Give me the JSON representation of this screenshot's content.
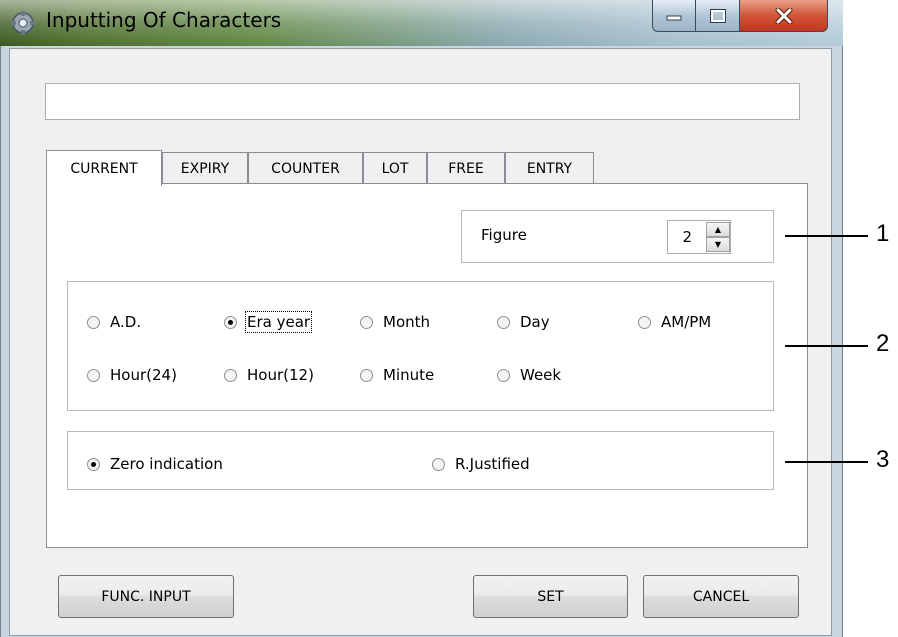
{
  "window": {
    "title": "Inputting Of Characters",
    "controls": {
      "minimize": "minimize",
      "maximize": "maximize",
      "close": "close"
    }
  },
  "text_input": {
    "value": "",
    "placeholder": ""
  },
  "tabs": [
    {
      "label": "CURRENT",
      "active": true
    },
    {
      "label": "EXPIRY",
      "active": false
    },
    {
      "label": "COUNTER",
      "active": false
    },
    {
      "label": "LOT",
      "active": false
    },
    {
      "label": "FREE",
      "active": false
    },
    {
      "label": "ENTRY",
      "active": false
    }
  ],
  "figure": {
    "label": "Figure",
    "value": "2",
    "up": "▲",
    "down": "▼"
  },
  "date_options": [
    {
      "label": "A.D.",
      "checked": false
    },
    {
      "label": "Era year",
      "checked": true
    },
    {
      "label": "Month",
      "checked": false
    },
    {
      "label": "Day",
      "checked": false
    },
    {
      "label": "AM/PM",
      "checked": false
    },
    {
      "label": "Hour(24)",
      "checked": false
    },
    {
      "label": "Hour(12)",
      "checked": false
    },
    {
      "label": "Minute",
      "checked": false
    },
    {
      "label": "Week",
      "checked": false
    }
  ],
  "justify_options": [
    {
      "label": "Zero indication",
      "checked": true
    },
    {
      "label": "R.Justified",
      "checked": false
    }
  ],
  "buttons": {
    "func_input": "FUNC. INPUT",
    "set": "SET",
    "cancel": "CANCEL"
  },
  "callouts": [
    "1",
    "2",
    "3"
  ],
  "colors": {
    "title_gradient_start": "#4d6f2c",
    "title_gradient_end": "#b4cbd8",
    "close": "#c2371c",
    "dialog_bg": "#f0f0f0"
  }
}
